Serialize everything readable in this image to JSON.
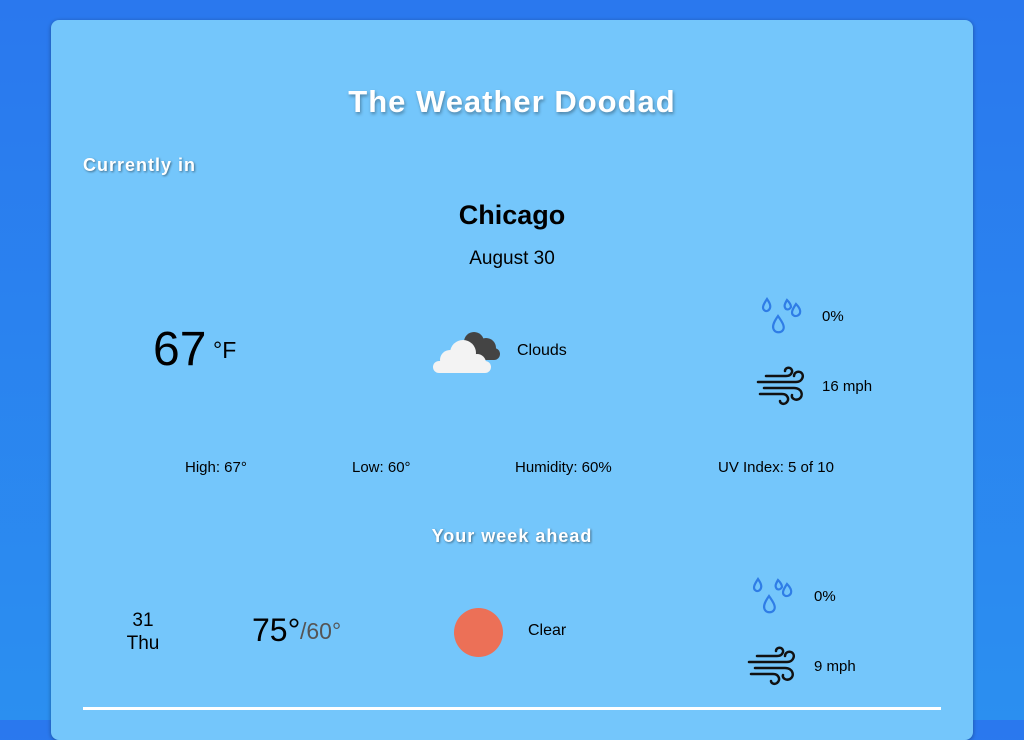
{
  "app": {
    "title": "The Weather Doodad"
  },
  "current": {
    "section_label": "Currently in",
    "city": "Chicago",
    "date": "August 30",
    "temp": "67",
    "unit": "°F",
    "condition": "Clouds",
    "condition_icon": "clouds-icon",
    "precip": "0%",
    "wind": "16 mph",
    "stats": {
      "high": "High: 67°",
      "low": "Low: 60°",
      "humidity": "Humidity: 60%",
      "uv": "UV Index: 5 of 10"
    }
  },
  "week": {
    "section_label": "Your week ahead",
    "days": [
      {
        "date": "31",
        "weekday": "Thu",
        "high": "75°",
        "low": "/60°",
        "condition": "Clear",
        "condition_icon": "sun-icon",
        "precip": "0%",
        "wind": "9 mph"
      }
    ]
  },
  "colors": {
    "background": "#2a78ee",
    "card": "#74c6fb",
    "sun": "#ec7057",
    "rain_drops": "#2f7de6"
  }
}
